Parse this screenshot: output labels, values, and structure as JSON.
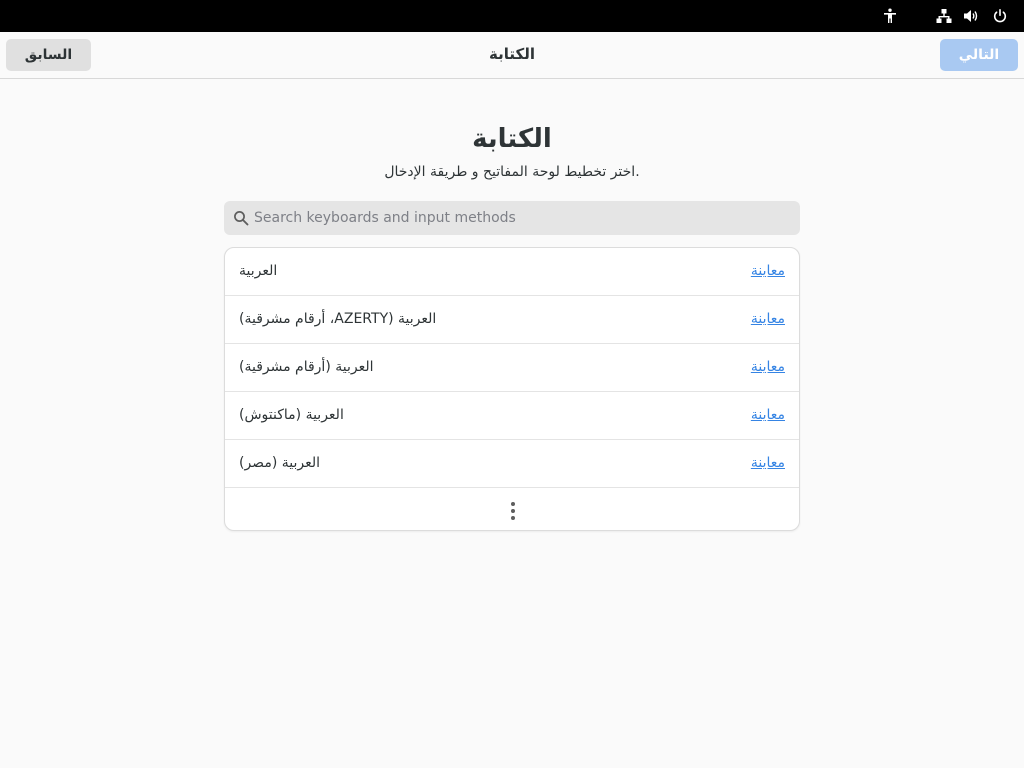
{
  "topbar": {
    "icons": [
      "accessibility-icon",
      "network-icon",
      "volume-icon",
      "power-icon"
    ]
  },
  "header": {
    "back_label": "السابق",
    "title": "الكتابة",
    "next_label": "التالي"
  },
  "main": {
    "title": "الكتابة",
    "subtitle": "اختر تخطيط لوحة المفاتيح و طريقة الإدخال.",
    "search_placeholder": "Search keyboards and input methods",
    "search_value": "",
    "layouts": [
      {
        "name": "العربية",
        "preview": "معاينة"
      },
      {
        "name": "العربية (AZERTY، أرقام مشرقية)",
        "preview": "معاينة"
      },
      {
        "name": "العربية (أرقام مشرقية)",
        "preview": "معاينة"
      },
      {
        "name": "العربية (ماكنتوش)",
        "preview": "معاينة"
      },
      {
        "name": "العربية (مصر)",
        "preview": "معاينة"
      }
    ],
    "more_icon": "view-more-icon"
  },
  "colors": {
    "accent": "#3584e4",
    "next_disabled": "#a9c9f2",
    "topbar": "#000000"
  }
}
